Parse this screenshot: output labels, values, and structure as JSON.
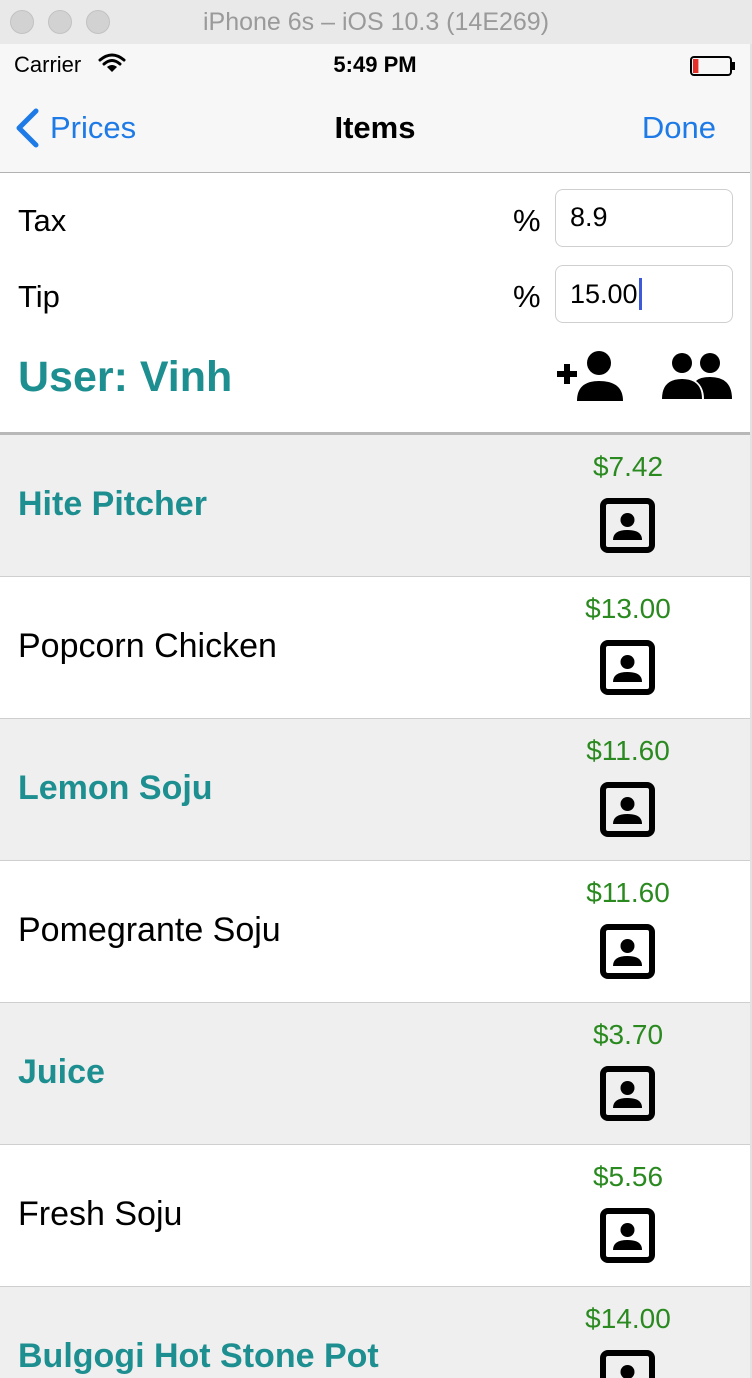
{
  "window": {
    "title": "iPhone 6s – iOS 10.3 (14E269)"
  },
  "status_bar": {
    "carrier": "Carrier",
    "time": "5:49 PM",
    "battery_level": 0.15
  },
  "nav": {
    "back_label": "Prices",
    "title": "Items",
    "done_label": "Done"
  },
  "settings": {
    "tax_label": "Tax",
    "tax_unit": "%",
    "tax_value": "8.9",
    "tip_label": "Tip",
    "tip_unit": "%",
    "tip_value": "15.00",
    "user_title": "User: Vinh"
  },
  "items": [
    {
      "name": "Hite Pitcher",
      "price": "$7.42",
      "highlighted": true
    },
    {
      "name": "Popcorn Chicken",
      "price": "$13.00",
      "highlighted": false
    },
    {
      "name": "Lemon Soju",
      "price": "$11.60",
      "highlighted": true
    },
    {
      "name": "Pomegrante Soju",
      "price": "$11.60",
      "highlighted": false
    },
    {
      "name": "Juice",
      "price": "$3.70",
      "highlighted": true
    },
    {
      "name": "Fresh Soju",
      "price": "$5.56",
      "highlighted": false
    },
    {
      "name": "Bulgogi Hot Stone Pot",
      "price": "$14.00",
      "highlighted": true
    }
  ],
  "colors": {
    "accent_blue": "#1d7ae6",
    "teal": "#1e8f90",
    "price_green": "#2a8a20",
    "battery_red": "#e5302a"
  },
  "icons": [
    "back-chevron-icon",
    "wifi-icon",
    "battery-icon",
    "add-user-icon",
    "group-icon",
    "contact-icon"
  ]
}
